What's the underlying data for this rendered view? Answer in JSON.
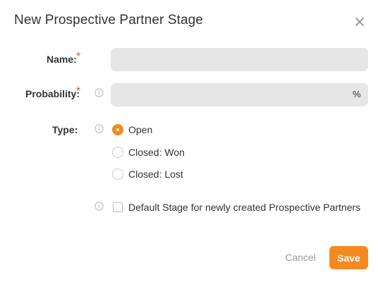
{
  "dialog": {
    "title": "New Prospective Partner Stage",
    "close_icon": "close-icon"
  },
  "form": {
    "name": {
      "label": "Name:",
      "required_mark": "*",
      "value": "",
      "placeholder": ""
    },
    "probability": {
      "label": "Probability:",
      "required_mark": "*",
      "value": "",
      "placeholder": "",
      "suffix": "%",
      "info_icon": "info-icon"
    },
    "type": {
      "label": "Type:",
      "info_icon": "info-icon",
      "options": [
        {
          "label": "Open",
          "selected": true
        },
        {
          "label": "Closed: Won",
          "selected": false
        },
        {
          "label": "Closed: Lost",
          "selected": false
        }
      ]
    },
    "default_stage": {
      "label": "Default Stage for newly created Prospective Partners",
      "checked": false,
      "info_icon": "info-icon"
    }
  },
  "actions": {
    "cancel_label": "Cancel",
    "save_label": "Save"
  },
  "colors": {
    "accent": "#f5891f",
    "required": "#e8582a",
    "input_bg": "#e6e6e6",
    "muted_text": "#9a9a9a"
  }
}
